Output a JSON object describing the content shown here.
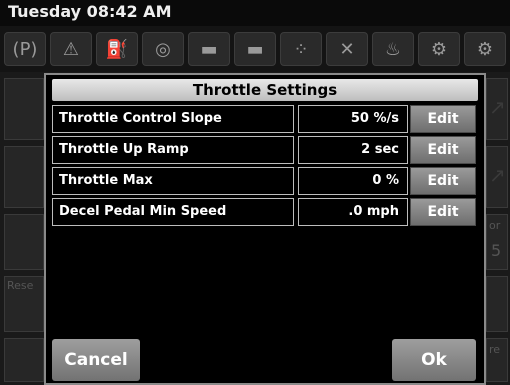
{
  "status_bar": {
    "datetime": "Tuesday 08:42 AM"
  },
  "indicator_icons": [
    {
      "name": "parking-brake-icon",
      "glyph": "(P)"
    },
    {
      "name": "warning-icon",
      "glyph": "⚠"
    },
    {
      "name": "fuel-filter-icon",
      "glyph": "⛽"
    },
    {
      "name": "oil-pressure-icon",
      "glyph": "◎"
    },
    {
      "name": "battery-icon",
      "glyph": "▬"
    },
    {
      "name": "battery-charge-icon",
      "glyph": "▬"
    },
    {
      "name": "transmission-icon",
      "glyph": "⁘"
    },
    {
      "name": "regen-icon",
      "glyph": "✕"
    },
    {
      "name": "coolant-temp-icon",
      "glyph": "♨"
    },
    {
      "name": "engine-icon",
      "glyph": "⚙"
    },
    {
      "name": "engine-check-icon",
      "glyph": "⚙"
    }
  ],
  "dialog": {
    "title": "Throttle Settings",
    "rows": [
      {
        "label": "Throttle Control Slope",
        "value": "50 %/s",
        "edit": "Edit"
      },
      {
        "label": "Throttle Up Ramp",
        "value": "2 sec",
        "edit": "Edit"
      },
      {
        "label": "Throttle Max",
        "value": "0 %",
        "edit": "Edit"
      },
      {
        "label": "Decel Pedal Min Speed",
        "value": ".0 mph",
        "edit": "Edit"
      }
    ],
    "cancel_label": "Cancel",
    "ok_label": "Ok"
  },
  "background": {
    "left_labels": [
      "Rese"
    ],
    "right_labels": [
      "or",
      "5",
      "re"
    ]
  },
  "colors": {
    "dialog_border": "#8a8a8a",
    "button_gradient_top": "#9e9e9e",
    "button_gradient_bottom": "#727272"
  }
}
